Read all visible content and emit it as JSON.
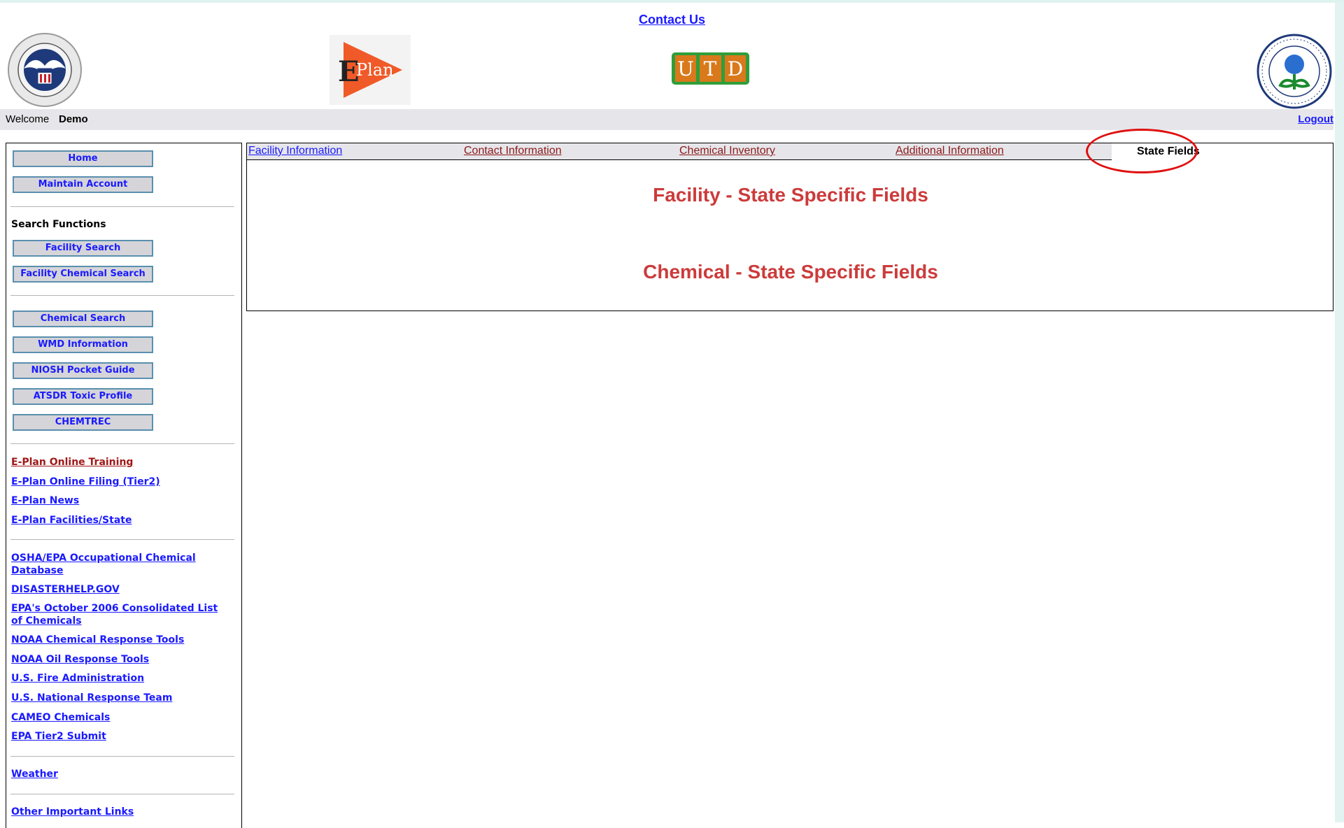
{
  "header": {
    "contact_label": "Contact Us",
    "welcome_label": "Welcome",
    "username": "Demo",
    "logout_label": "Logout",
    "logos": [
      "dhs-seal",
      "eplan-logo",
      "utd-logo",
      "epa-seal"
    ],
    "eplan_text": [
      "E",
      "Plan"
    ],
    "utd_letters": [
      "U",
      "T",
      "D"
    ]
  },
  "sidebar": {
    "top_buttons": [
      "Home",
      "Maintain Account"
    ],
    "search_title": "Search Functions",
    "search_buttons": [
      "Facility Search",
      "Facility Chemical Search"
    ],
    "tool_buttons": [
      "Chemical Search",
      "WMD Information",
      "NIOSH Pocket Guide",
      "ATSDR Toxic Profile",
      "CHEMTREC"
    ],
    "eplan_links": [
      "E-Plan Online Training",
      "E-Plan Online Filing (Tier2)",
      "E-Plan News",
      "E-Plan Facilities/State"
    ],
    "resource_links": [
      "OSHA/EPA Occupational Chemical Database",
      "DISASTERHELP.GOV",
      "EPA's October 2006 Consolidated List of Chemicals",
      "NOAA Chemical Response Tools",
      "NOAA Oil Response Tools",
      "U.S. Fire Administration",
      "U.S. National Response Team",
      "CAMEO Chemicals",
      "EPA Tier2 Submit"
    ],
    "weather_link": "Weather",
    "other_link": "Other Important Links"
  },
  "tabs": {
    "items": [
      "Facility Information",
      "Contact Information",
      "Chemical Inventory",
      "Additional Information"
    ],
    "active": "State Fields"
  },
  "content": {
    "facility_heading": "Facility - State Specific Fields",
    "chemical_heading": "Chemical - State Specific Fields"
  },
  "colors": {
    "link": "#1a1aff",
    "visited_link": "#8b1a1a",
    "heading": "#cc3b3b",
    "highlight_ring": "#e01010",
    "button_bg": "#d5d5d9",
    "button_border": "#5a8fae"
  }
}
